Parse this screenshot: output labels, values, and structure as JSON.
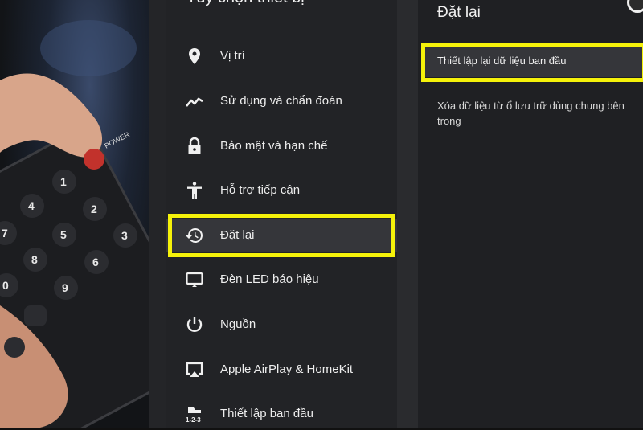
{
  "middle_panel": {
    "title": "Tùy chọn thiết bị",
    "items": [
      {
        "label": "Vị trí",
        "icon": "location-pin-icon"
      },
      {
        "label": "Sử dụng và chẩn đoán",
        "icon": "trend-line-icon"
      },
      {
        "label": "Bảo mật và hạn chế",
        "icon": "lock-icon"
      },
      {
        "label": "Hỗ trợ tiếp cận",
        "icon": "accessibility-icon"
      },
      {
        "label": "Đặt lại",
        "icon": "history-icon",
        "selected": true
      },
      {
        "label": "Đèn LED báo hiệu",
        "icon": "screen-led-icon"
      },
      {
        "label": "Nguồn",
        "icon": "power-icon"
      },
      {
        "label": "Apple AirPlay & HomeKit",
        "icon": "airplay-icon"
      },
      {
        "label": "Thiết lập ban đầu",
        "icon": "setup-123-icon"
      }
    ]
  },
  "right_panel": {
    "title": "Đặt lại",
    "option": "Thiết lập lại dữ liệu ban đầu",
    "description": "Xóa dữ liệu từ ổ lưu trữ dùng chung bên trong"
  },
  "photo": {
    "power_label": "POWER",
    "keys": [
      "1",
      "2",
      "3",
      "4",
      "5",
      "6",
      "7",
      "8",
      "9",
      "0"
    ]
  },
  "colors": {
    "highlight": "#f5f20a",
    "panel_bg": "#222326",
    "selected_bg": "#35363a"
  }
}
